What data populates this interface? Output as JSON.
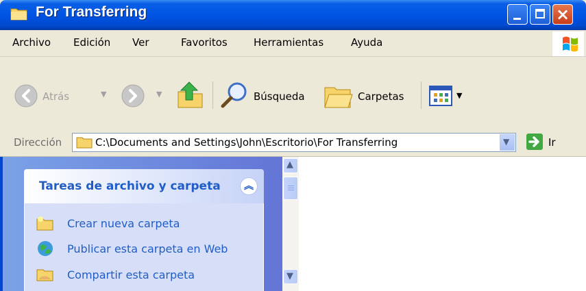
{
  "window": {
    "title": "For Transferring"
  },
  "menu": [
    "Archivo",
    "Edición",
    "Ver",
    "Favoritos",
    "Herramientas",
    "Ayuda"
  ],
  "toolbar": {
    "back_label": "Atrás",
    "search_label": "Búsqueda",
    "folders_label": "Carpetas"
  },
  "address": {
    "label": "Dirección",
    "path": "C:\\Documents and Settings\\John\\Escritorio\\For Transferring",
    "go_label": "Ir"
  },
  "tasks": {
    "title": "Tareas de archivo y carpeta",
    "items": [
      {
        "label": "Crear nueva carpeta",
        "icon": "new-folder-icon"
      },
      {
        "label": "Publicar esta carpeta en Web",
        "icon": "publish-web-icon"
      },
      {
        "label": "Compartir esta carpeta",
        "icon": "share-folder-icon"
      }
    ]
  },
  "colors": {
    "titlebar": "#0054e3",
    "task_link": "#215dc6",
    "task_pane": "#6375d6"
  }
}
